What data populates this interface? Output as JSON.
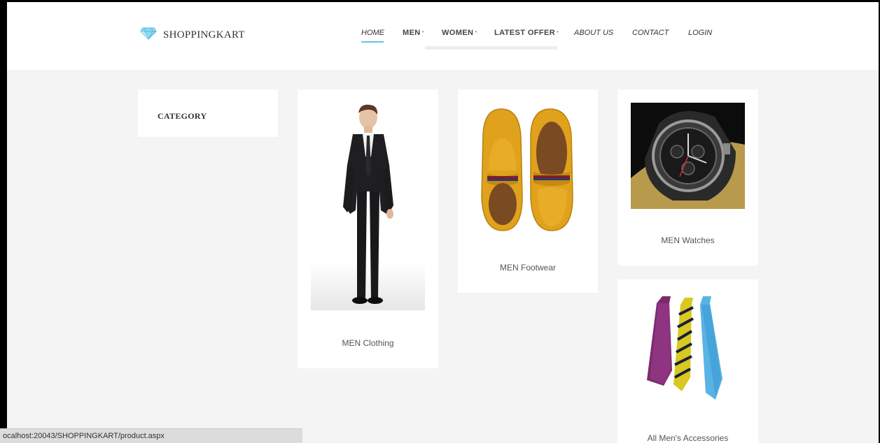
{
  "header": {
    "brand": "SHOPPINGKART",
    "brand_icon": "diamond-icon",
    "nav": [
      {
        "label": "HOME"
      },
      {
        "label": "MEN"
      },
      {
        "label": "WOMEN"
      },
      {
        "label": "LATEST OFFER"
      },
      {
        "label": "ABOUT US"
      },
      {
        "label": "CONTACT"
      },
      {
        "label": "LOGIN"
      }
    ]
  },
  "sidebar": {
    "title": "CATEGORY"
  },
  "products": [
    {
      "label": "MEN Clothing",
      "image": "man-in-suit"
    },
    {
      "label": "MEN Footwear",
      "image": "loafer-shoes"
    },
    {
      "label": "MEN Watches",
      "image": "wrist-watch"
    },
    {
      "label": "All Men's Accessories",
      "image": "neckties"
    }
  ],
  "status_bar": {
    "url": "ocalhost:20043/SHOPPINGKART/product.aspx"
  },
  "colors": {
    "accent": "#5cc8e8",
    "background": "#f4f4f4"
  }
}
